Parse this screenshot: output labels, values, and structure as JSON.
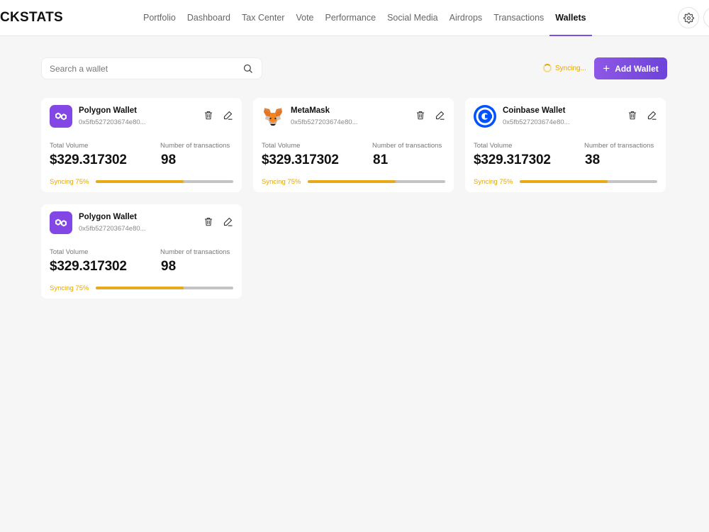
{
  "app": {
    "logo_text": "CKSTATS"
  },
  "nav": {
    "items": [
      {
        "label": "Portfolio"
      },
      {
        "label": "Dashboard"
      },
      {
        "label": "Tax Center"
      },
      {
        "label": "Vote"
      },
      {
        "label": "Performance"
      },
      {
        "label": "Social Media"
      },
      {
        "label": "Airdrops"
      },
      {
        "label": "Transactions"
      },
      {
        "label": "Wallets",
        "active": true
      }
    ]
  },
  "search": {
    "placeholder": "Search a wallet",
    "value": ""
  },
  "sync_status": {
    "label": "Syncing..."
  },
  "toolbar": {
    "add_wallet_label": "Add Wallet"
  },
  "colors": {
    "accent": "#7b4fe0",
    "sync": "#e4a600",
    "polygon": "#8247e5",
    "coinbase": "#0052ff"
  },
  "wallets": [
    {
      "name": "Polygon Wallet",
      "icon": "polygon-icon",
      "address": "0x5fb527203674e80...",
      "volume_label": "Total Volume",
      "volume": "$329.317302",
      "tx_label": "Number of transactions",
      "tx_count": "98",
      "sync_label": "Syncing 75%",
      "sync_progress": 0.64
    },
    {
      "name": "MetaMask",
      "icon": "metamask-icon",
      "address": "0x5fb527203674e80...",
      "volume_label": "Total Volume",
      "volume": "$329.317302",
      "tx_label": "Number of transactions",
      "tx_count": "81",
      "sync_label": "Syncing 75%",
      "sync_progress": 0.64
    },
    {
      "name": "Coinbase Wallet",
      "icon": "coinbase-icon",
      "address": "0x5fb527203674e80...",
      "volume_label": "Total Volume",
      "volume": "$329.317302",
      "tx_label": "Number of transactions",
      "tx_count": "38",
      "sync_label": "Syncing 75%",
      "sync_progress": 0.64
    },
    {
      "name": "Polygon Wallet",
      "icon": "polygon-icon",
      "address": "0x5fb527203674e80...",
      "volume_label": "Total Volume",
      "volume": "$329.317302",
      "tx_label": "Number of transactions",
      "tx_count": "98",
      "sync_label": "Syncing 75%",
      "sync_progress": 0.64
    }
  ]
}
